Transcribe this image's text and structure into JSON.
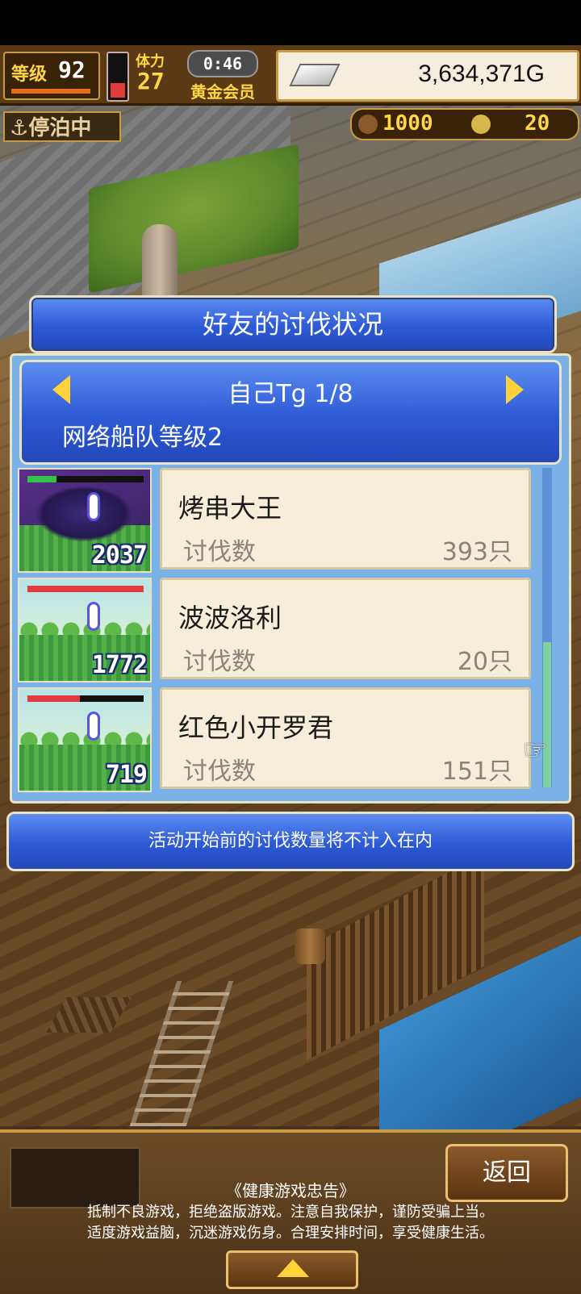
{
  "hud": {
    "level_label": "等级",
    "level_value": "92",
    "stamina_label": "体力",
    "stamina_value": "27",
    "stamina_fraction": 0.35,
    "timer": "0:46",
    "membership": "黄金会员",
    "gold": "3,634,371G",
    "status": "停泊中",
    "resource_1": "1000",
    "resource_2": "20"
  },
  "dialog": {
    "title": "好友的讨伐状况",
    "page_label": "自己Tg 1/8",
    "fleet_level": "网络船队等级2",
    "notice": "活动开始前的讨伐数量将不计入在内",
    "rows": [
      {
        "name": "烤串大王",
        "kill_label": "讨伐数",
        "kill_value": "393只",
        "boss_count": "2037",
        "hp_fraction": 0.25,
        "theme": "dark"
      },
      {
        "name": "波波洛利",
        "kill_label": "讨伐数",
        "kill_value": "20只",
        "boss_count": "1772",
        "hp_fraction": 1.0,
        "theme": "field"
      },
      {
        "name": "红色小开罗君",
        "kill_label": "讨伐数",
        "kill_value": "151只",
        "boss_count": "719",
        "hp_fraction": 0.45,
        "theme": "field"
      }
    ]
  },
  "footer": {
    "back_label": "返回",
    "notice_title": "《健康游戏忠告》",
    "notice_line_1": "抵制不良游戏，拒绝盗版游戏。注意自我保护，谨防受骗上当。",
    "notice_line_2": "适度游戏益脑，沉迷游戏伤身。合理安排时间，享受健康生活。"
  },
  "colors": {
    "panel_blue": "#2d5ad6",
    "card_bg": "#f6eed8",
    "gold_text": "#ffd64a",
    "hp_red": "#e23b3b",
    "hp_green": "#35c24a"
  },
  "icons": {
    "anchor": "anchor-icon",
    "silver_bar": "silver-bar-icon",
    "left_arrow": "left-arrow-icon",
    "right_arrow": "right-arrow-icon",
    "pointer": "hand-pointer-icon",
    "expand": "up-triangle-icon"
  }
}
